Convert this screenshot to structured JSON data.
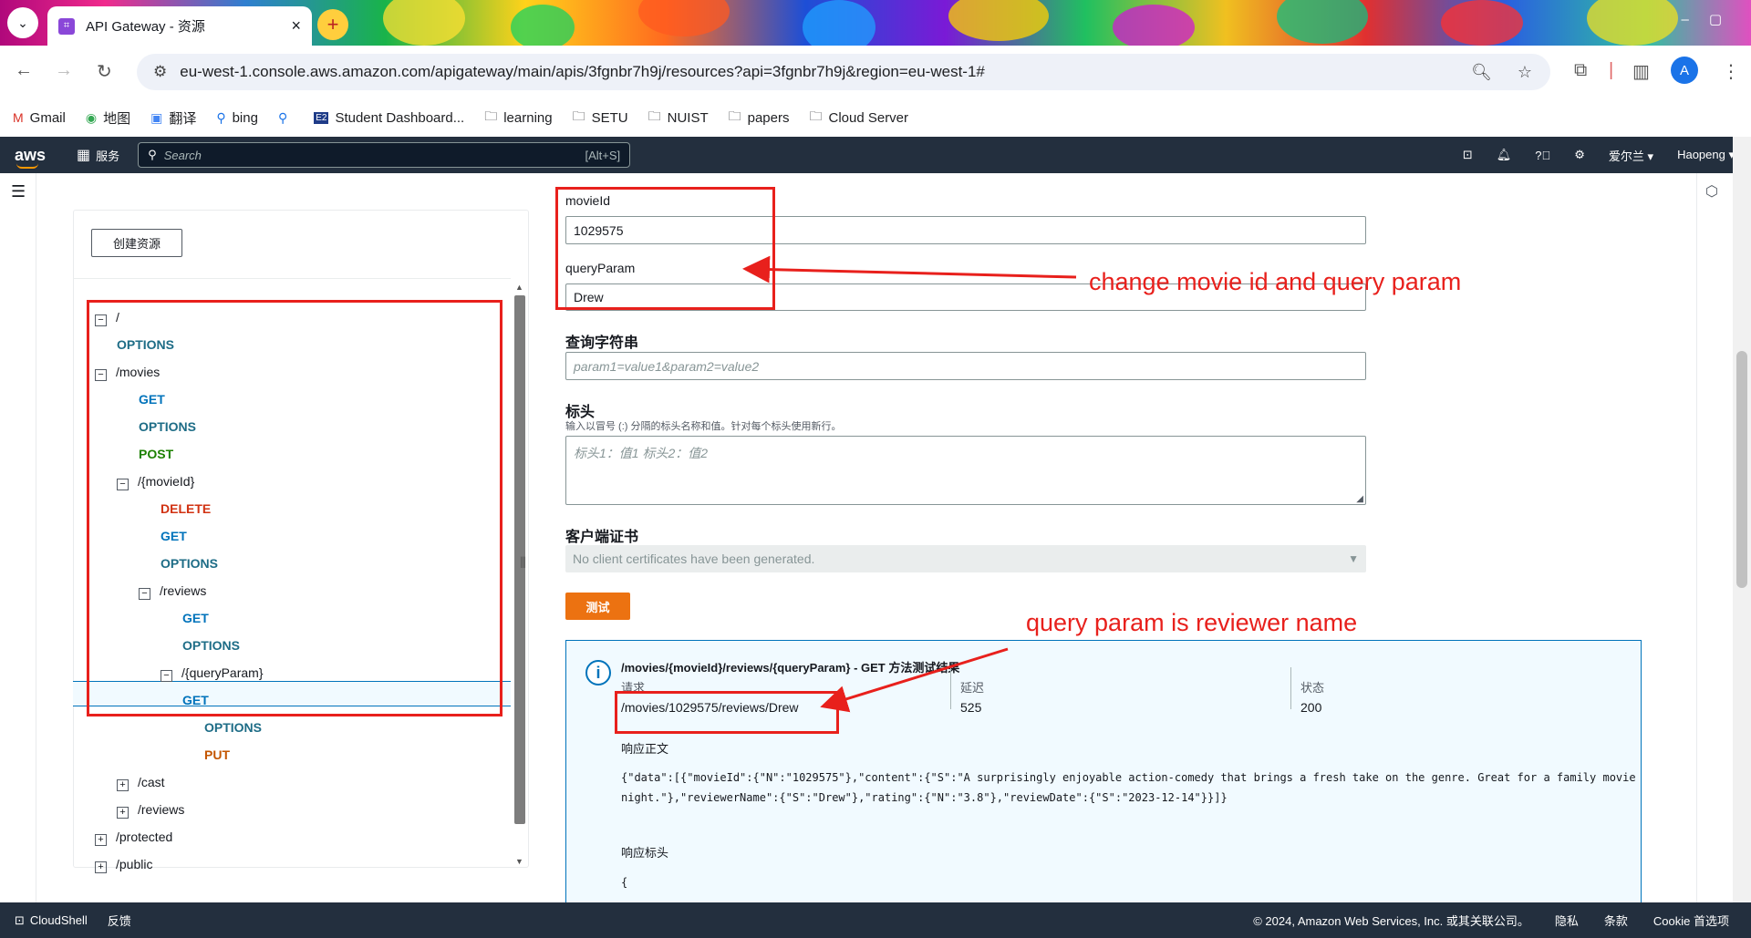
{
  "browser": {
    "tab_title": "API Gateway - 资源",
    "url": "eu-west-1.console.aws.amazon.com/apigateway/main/apis/3fgnbr7h9j/resources?api=3fgnbr7h9j&region=eu-west-1#",
    "profile_initial": "A",
    "bookmarks": [
      "Gmail",
      "地图",
      "翻译",
      "bing",
      "",
      "Student Dashboard...",
      "learning",
      "SETU",
      "NUIST",
      "papers",
      "Cloud Server"
    ]
  },
  "aws": {
    "logo": "aws",
    "services_label": "服务",
    "search_placeholder": "Search",
    "search_shortcut": "[Alt+S]",
    "region": "爱尔兰",
    "user": "Haopeng"
  },
  "resources": {
    "create_button": "创建资源",
    "tree": [
      {
        "label": "/",
        "kind": "path",
        "toggle": "−"
      },
      {
        "label": "OPTIONS",
        "kind": "opt"
      },
      {
        "label": "/movies",
        "kind": "path",
        "toggle": "−"
      },
      {
        "label": "GET",
        "kind": "get"
      },
      {
        "label": "OPTIONS",
        "kind": "opt"
      },
      {
        "label": "POST",
        "kind": "post"
      },
      {
        "label": "/{movieId}",
        "kind": "path",
        "toggle": "−"
      },
      {
        "label": "DELETE",
        "kind": "del"
      },
      {
        "label": "GET",
        "kind": "get"
      },
      {
        "label": "OPTIONS",
        "kind": "opt"
      },
      {
        "label": "/reviews",
        "kind": "path",
        "toggle": "−"
      },
      {
        "label": "GET",
        "kind": "get"
      },
      {
        "label": "OPTIONS",
        "kind": "opt"
      },
      {
        "label": "/{queryParam}",
        "kind": "path",
        "toggle": "−"
      },
      {
        "label": "GET",
        "kind": "get",
        "selected": true
      },
      {
        "label": "OPTIONS",
        "kind": "opt"
      },
      {
        "label": "PUT",
        "kind": "put"
      },
      {
        "label": "/cast",
        "kind": "path",
        "toggle": "+"
      },
      {
        "label": "/reviews",
        "kind": "path",
        "toggle": "+"
      },
      {
        "label": "/protected",
        "kind": "path",
        "toggle": "+"
      },
      {
        "label": "/public",
        "kind": "path",
        "toggle": "+"
      }
    ]
  },
  "form": {
    "movieid_label": "movieId",
    "movieid_value": "1029575",
    "queryparam_label": "queryParam",
    "queryparam_value": "Drew",
    "querystring_heading": "查询字符串",
    "querystring_placeholder": "param1=value1&param2=value2",
    "headers_heading": "标头",
    "headers_hint": "输入以冒号 (:) 分隔的标头名称和值。针对每个标头使用新行。",
    "headers_placeholder": "标头1：值1 标头2：值2",
    "cert_heading": "客户端证书",
    "cert_value": "No client certificates have been generated.",
    "test_button": "测试"
  },
  "result": {
    "title": "/movies/{movieId}/reviews/{queryParam} - GET 方法测试结果",
    "request_label": "请求",
    "request_value": "/movies/1029575/reviews/Drew",
    "latency_label": "延迟",
    "latency_value": "525",
    "status_label": "状态",
    "status_value": "200",
    "body_label": "响应正文",
    "body_line1": "{\"data\":[{\"movieId\":{\"N\":\"1029575\"},\"content\":{\"S\":\"A surprisingly enjoyable action-comedy that brings a fresh take on the genre. Great for a family movie",
    "body_line2": "night.\"},\"reviewerName\":{\"S\":\"Drew\"},\"rating\":{\"N\":\"3.8\"},\"reviewDate\":{\"S\":\"2023-12-14\"}}]}",
    "headers_label": "响应标头",
    "headers_line1": "{"
  },
  "annotations": {
    "top": "change movie id and query param",
    "bottom": "query param is reviewer name",
    "color": "#e8201c"
  },
  "footer": {
    "cloudshell": "CloudShell",
    "feedback": "反馈",
    "copyright": "© 2024, Amazon Web Services, Inc. 或其关联公司。",
    "privacy": "隐私",
    "terms": "条款",
    "cookies": "Cookie 首选项"
  }
}
